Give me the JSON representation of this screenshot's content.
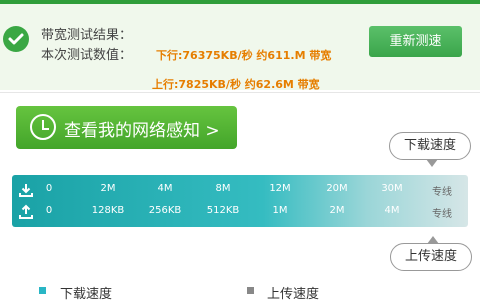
{
  "result": {
    "title_label": "带宽测试结果：",
    "value_label": "本次测试数值：",
    "download_line": "下行:76375KB/秒 约611.M 带宽",
    "upload_line": "上行:7825KB/秒 约62.6M 带宽",
    "retest_button": "重新测速",
    "status_icon": "check-icon"
  },
  "promo": {
    "button_label": "查看我的网络感知 >",
    "icon": "clock-icon"
  },
  "bubbles": {
    "download": "下载速度",
    "upload": "上传速度"
  },
  "scale": {
    "download_icon": "download-icon",
    "upload_icon": "upload-icon",
    "download_ticks": [
      "0",
      "2M",
      "4M",
      "8M",
      "12M",
      "20M",
      "30M",
      "专线"
    ],
    "upload_ticks": [
      "0",
      "128KB",
      "256KB",
      "512KB",
      "1M",
      "2M",
      "4M",
      "专线"
    ]
  },
  "legend": {
    "download": "下载速度",
    "upload": "上传速度"
  },
  "colors": {
    "accent_green": "#3aa744",
    "result_orange": "#e67e00",
    "scale_teal": "#1aa2a6"
  }
}
